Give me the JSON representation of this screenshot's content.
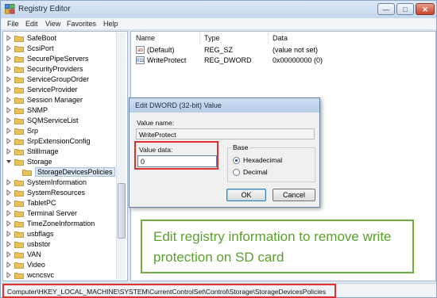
{
  "window": {
    "title": "Registry Editor"
  },
  "menu": [
    "File",
    "Edit",
    "View",
    "Favorites",
    "Help"
  ],
  "tree": [
    {
      "label": "SafeBoot",
      "sub": false
    },
    {
      "label": "ScsiPort",
      "sub": false
    },
    {
      "label": "SecurePipeServers",
      "sub": false
    },
    {
      "label": "SecurityProviders",
      "sub": false
    },
    {
      "label": "ServiceGroupOrder",
      "sub": false
    },
    {
      "label": "ServiceProvider",
      "sub": false
    },
    {
      "label": "Session Manager",
      "sub": false
    },
    {
      "label": "SNMP",
      "sub": false
    },
    {
      "label": "SQMServiceList",
      "sub": false
    },
    {
      "label": "Srp",
      "sub": false
    },
    {
      "label": "SrpExtensionConfig",
      "sub": false
    },
    {
      "label": "StillImage",
      "sub": false
    },
    {
      "label": "Storage",
      "sub": false
    },
    {
      "label": "StorageDevicesPolicies",
      "sub": true
    },
    {
      "label": "SystemInformation",
      "sub": false
    },
    {
      "label": "SystemResources",
      "sub": false
    },
    {
      "label": "TabletPC",
      "sub": false
    },
    {
      "label": "Terminal Server",
      "sub": false
    },
    {
      "label": "TimeZoneInformation",
      "sub": false
    },
    {
      "label": "usbflags",
      "sub": false
    },
    {
      "label": "usbstor",
      "sub": false
    },
    {
      "label": "VAN",
      "sub": false
    },
    {
      "label": "Video",
      "sub": false
    },
    {
      "label": "wcncsvc",
      "sub": false
    }
  ],
  "values": {
    "headers": {
      "name": "Name",
      "type": "Type",
      "data": "Data"
    },
    "rows": [
      {
        "icon": "string-value-icon",
        "badge": "ab",
        "name": "(Default)",
        "type": "REG_SZ",
        "data": "(value not set)"
      },
      {
        "icon": "dword-value-icon",
        "badge": "011",
        "name": "WriteProtect",
        "type": "REG_DWORD",
        "data": "0x00000000 (0)"
      }
    ]
  },
  "dialog": {
    "title": "Edit DWORD (32-bit) Value",
    "value_name_label": "Value name:",
    "value_name": "WriteProtect",
    "value_data_label": "Value data:",
    "value_data": "0",
    "base_label": "Base",
    "hex_label": "Hexadecimal",
    "dec_label": "Decimal",
    "selected_base": "Hexadecimal",
    "ok_label": "OK",
    "cancel_label": "Cancel"
  },
  "callout": {
    "text": "Edit registry information to remove write protection on SD card"
  },
  "status": {
    "path": "Computer\\HKEY_LOCAL_MACHINE\\SYSTEM\\CurrentControlSet\\Control\\Storage\\StorageDevicesPolicies"
  },
  "colors": {
    "highlight": "#e03030",
    "callout": "#5aa02c",
    "folder": "#e8c25a"
  }
}
